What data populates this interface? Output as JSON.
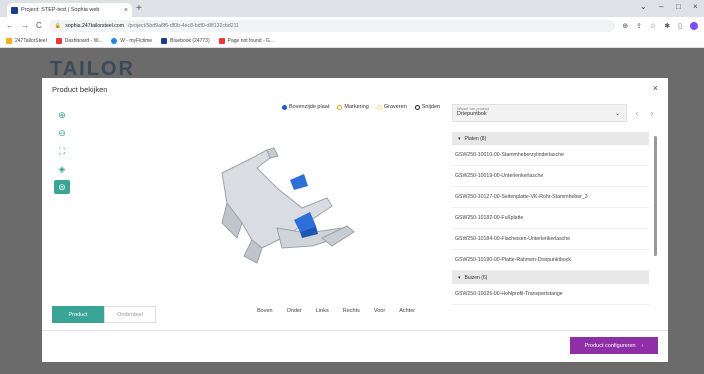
{
  "browser": {
    "tab_title": "Project: STEP-test | Sophia web",
    "tab_close": "×",
    "newtab": "+",
    "controls": [
      "⌄",
      "–",
      "□",
      "×"
    ],
    "nav": [
      "←",
      "→",
      "C"
    ],
    "url_host": "sophia.247tailorsteel.com",
    "url_path": "/project/5bd9a8f6-df0b-4ec8-bdf0-d8f132cbd211",
    "lock": "🔒",
    "right_icons": [
      "⊕",
      "⇪",
      "☆",
      "✱",
      "▯"
    ],
    "bookmarks": [
      {
        "label": "247TailorSteel",
        "color": "#f2b01e"
      },
      {
        "label": "Dashboard - W...",
        "color": "#e53935"
      },
      {
        "label": "W - myFictime",
        "color": "#1e88e5"
      },
      {
        "label": "Bluebook (24773)",
        "color": "#1a3d8f"
      },
      {
        "label": "Page not found - G...",
        "color": "#e53935"
      }
    ]
  },
  "page": {
    "brand": "TAILOR"
  },
  "modal": {
    "title": "Product bekijken",
    "close": "×",
    "tools": [
      {
        "name": "zoom-in-icon",
        "glyph": "⊕"
      },
      {
        "name": "zoom-out-icon",
        "glyph": "⊖"
      },
      {
        "name": "fit-icon",
        "glyph": "⛶"
      },
      {
        "name": "layers-icon",
        "glyph": "◈"
      },
      {
        "name": "view-mode-icon",
        "glyph": "⊜"
      }
    ],
    "legend": [
      {
        "label": "Bovenzijde plaat",
        "color": "#1f5bd6",
        "filled": true
      },
      {
        "label": "Markering",
        "color": "#f5a623",
        "filled": false
      },
      {
        "label": "Graveren",
        "color": "#f8e37a",
        "filled": false
      },
      {
        "label": "Snijden",
        "color": "#222222",
        "filled": false
      }
    ],
    "bottom_tabs": [
      "Product",
      "Onderdeel"
    ],
    "views": [
      "Boven",
      "Onder",
      "Links",
      "Rechts",
      "Voor",
      "Achter"
    ],
    "select_label": "Wissel van product",
    "select_value": "Driepuntbok",
    "nav_prev": "‹",
    "nav_next": "›",
    "groups": [
      {
        "label": "Platen (8)",
        "items": [
          "GSW250-10010-00-Stammheberzylinderlasche",
          "GSW250-10019-00-Unterlenkerlasche",
          "GSW250-10127-00-Seitenplatte-VK-Rohr-Stammheber_3",
          "GSW250-10182-00-Fußplatte",
          "GSW250-10184-00-Flacheisen-Unterlenkerlasche",
          "GSW250-10190-00-Platte-Rahmen-Dreipunktbock"
        ]
      },
      {
        "label": "Buizen (6)",
        "items": [
          "GSW250-10026-00-Hohlprofil-Transportstange"
        ]
      }
    ],
    "cta_label": "Product configureren",
    "cta_arrow": "›"
  }
}
